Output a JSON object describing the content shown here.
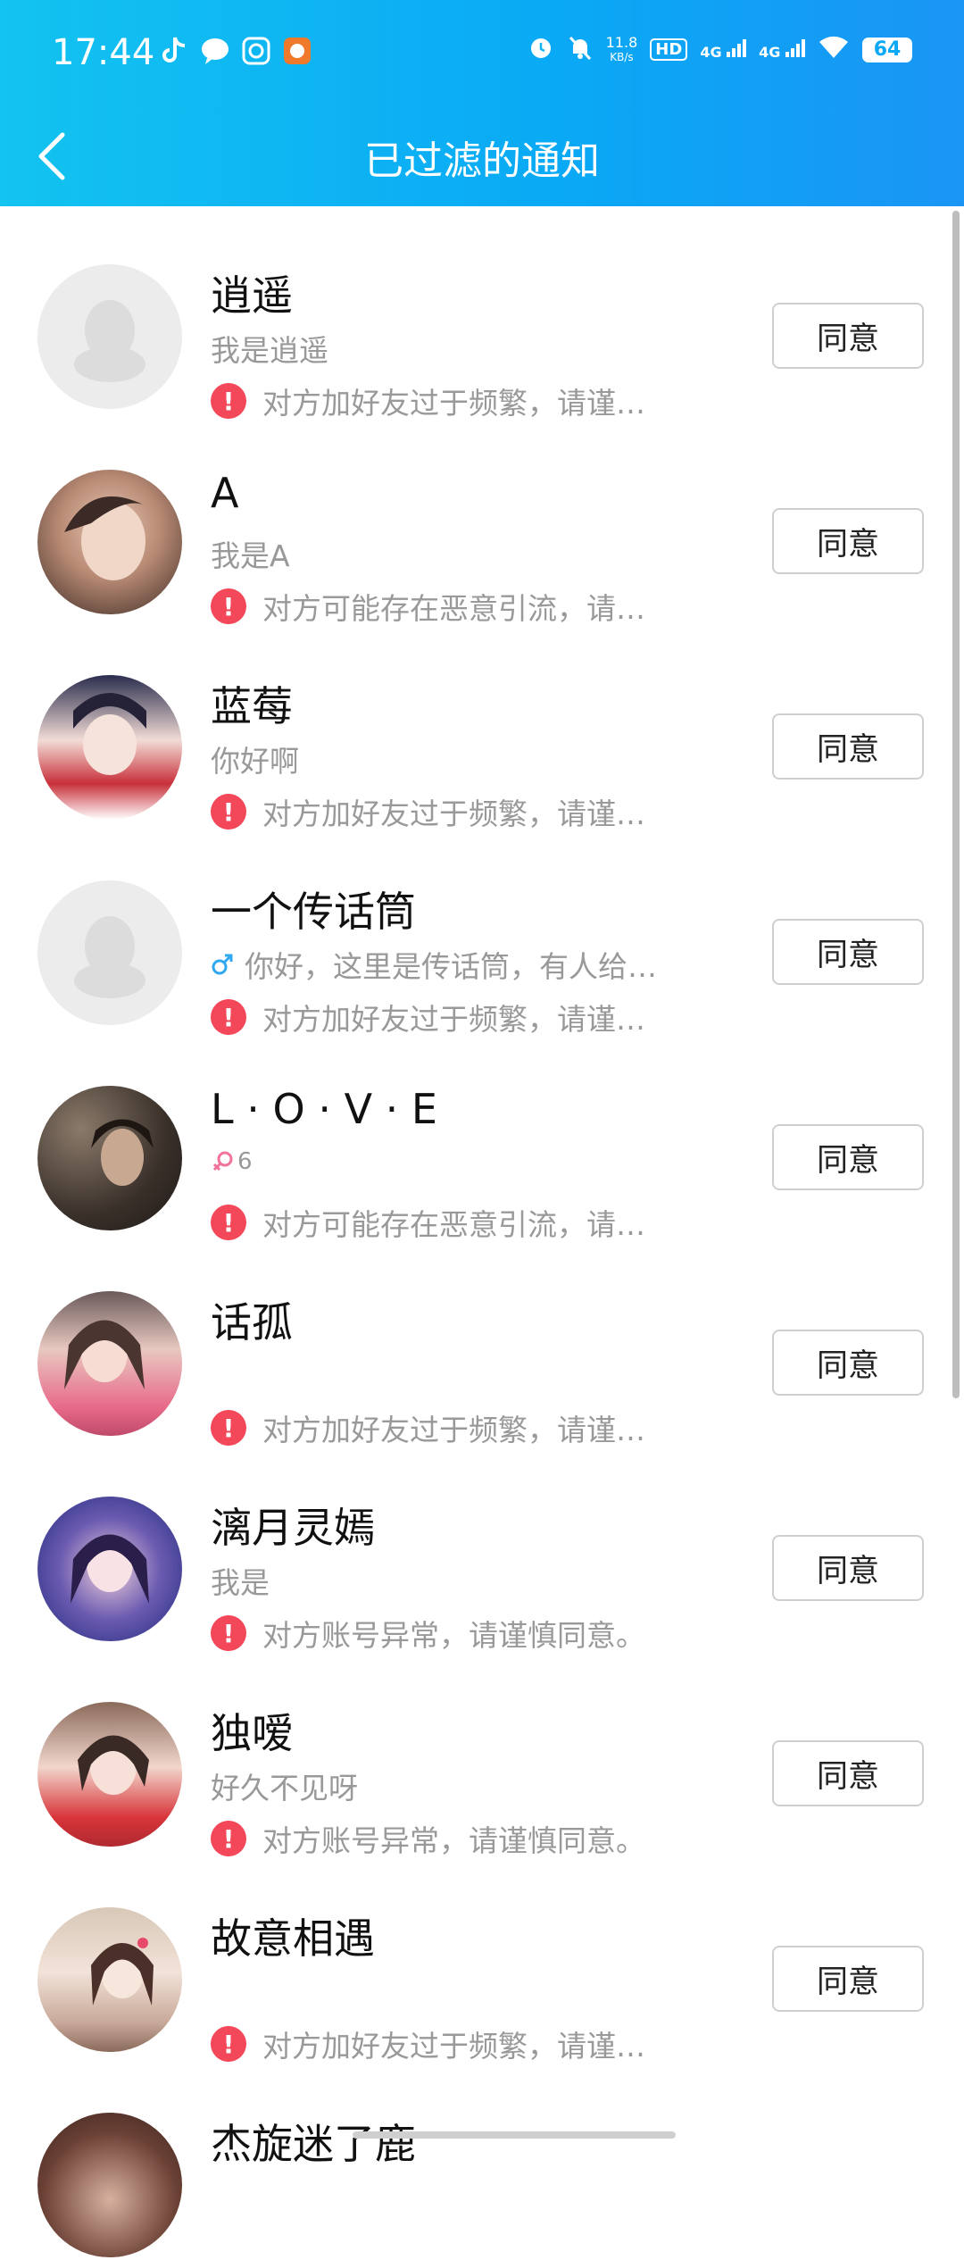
{
  "status_bar": {
    "time": "17:44",
    "net_speed_value": "11.8",
    "net_speed_unit": "KB/s",
    "hd_label": "HD",
    "signal1_label": "4G",
    "signal2_label": "4G",
    "battery": "64"
  },
  "nav": {
    "title": "已过滤的通知"
  },
  "agree_label": "同意",
  "warnings": {
    "frequent": "对方加好友过于频繁，请谨…",
    "malicious": "对方可能存在恶意引流，请…",
    "abnormal": "对方账号异常，请谨慎同意。"
  },
  "items": [
    {
      "name": "逍遥",
      "message": "我是逍遥",
      "warning": "对方加好友过于频繁，请谨…"
    },
    {
      "name": "A",
      "message": "我是A",
      "warning": "对方可能存在恶意引流，请…"
    },
    {
      "name": "蓝莓",
      "message": "你好啊",
      "warning": "对方加好友过于频繁，请谨…"
    },
    {
      "name": "一个传话筒",
      "message": "你好，这里是传话筒，有人给…",
      "warning": "对方加好友过于频繁，请谨…"
    },
    {
      "name": "L · O · V · E",
      "message": "6",
      "warning": "对方可能存在恶意引流，请…"
    },
    {
      "name": "话孤",
      "message": "",
      "warning": "对方加好友过于频繁，请谨…"
    },
    {
      "name": "漓月灵嫣",
      "message": "我是",
      "warning": "对方账号异常，请谨慎同意。"
    },
    {
      "name": "独嗳",
      "message": "好久不见呀",
      "warning": "对方账号异常，请谨慎同意。"
    },
    {
      "name": "故意相遇",
      "message": "",
      "warning": "对方加好友过于频繁，请谨…"
    },
    {
      "name": "杰旋迷了鹿",
      "message": "",
      "warning": ""
    }
  ],
  "colors": {
    "header_start": "#13c3f0",
    "header_end": "#1a95f5",
    "warning_red": "#f2485a",
    "male_blue": "#2fa8f2",
    "female_pink": "#f2739a"
  }
}
